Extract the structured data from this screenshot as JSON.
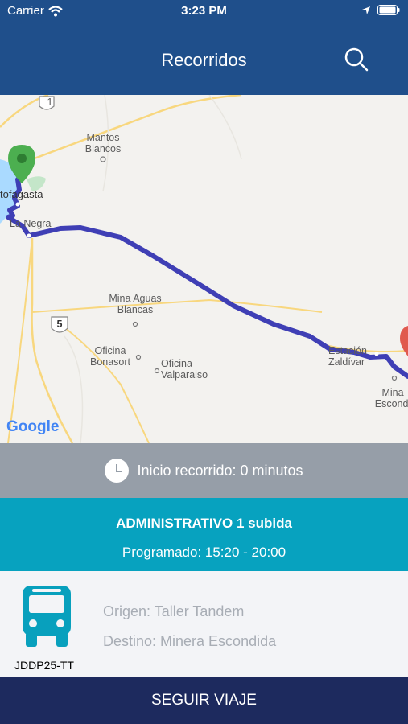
{
  "status": {
    "carrier": "Carrier",
    "time": "3:23 PM"
  },
  "nav": {
    "title": "Recorridos",
    "search_icon": "search-icon"
  },
  "map": {
    "labels": {
      "mantos": "Mantos\nBlancos",
      "antofagasta": "tofagasta",
      "lanegra": "La Negra",
      "aguas": "Mina Aguas\nBlancas",
      "bonasort": "Oficina\nBonasort",
      "valparaiso": "Oficina\nValparaiso",
      "estacion": "Estación\nZaldívar",
      "escondida": "Mina\nEscondi"
    },
    "shields": {
      "r1": "1",
      "r5": "5"
    },
    "attribution": "Google",
    "route_color": "#3f3fb5"
  },
  "trip": {
    "inicio": "Inicio recorrido: 0 minutos",
    "route_name": "ADMINISTRATIVO 1 subida",
    "schedule": "Programado: 15:20 - 20:00"
  },
  "vehicle": {
    "plate": "JDDP25-TT",
    "origin": "Origen: Taller Tandem",
    "destination": "Destino: Minera Escondida",
    "icon": "bus-icon"
  },
  "action": {
    "label": "SEGUIR VIAJE"
  }
}
